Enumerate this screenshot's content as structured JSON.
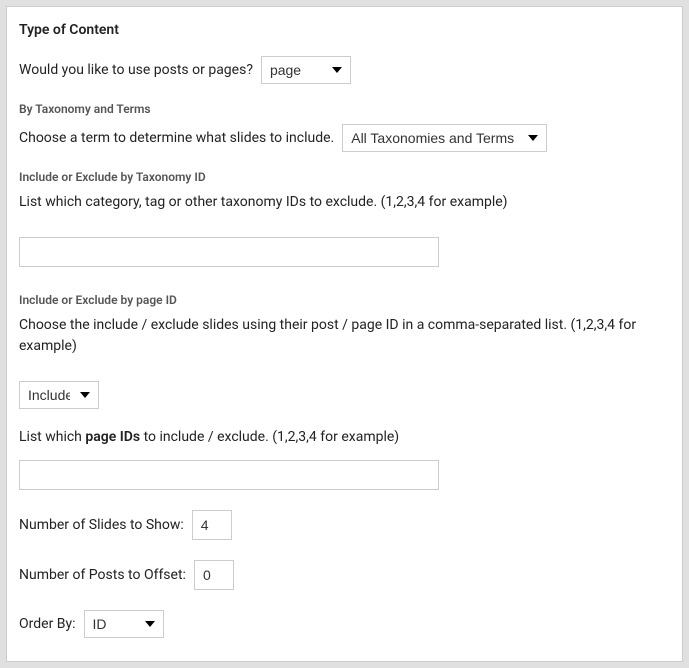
{
  "title": "Type of Content",
  "posts_or_pages": {
    "label": "Would you like to use posts or pages?",
    "value": "page"
  },
  "taxonomy": {
    "heading": "By Taxonomy and Terms",
    "label": "Choose a term to determine what slides to include.",
    "value": "All Taxonomies and Terms"
  },
  "exclude_tax": {
    "heading": "Include or Exclude by Taxonomy ID",
    "desc": "List which category, tag or other taxonomy IDs to exclude. (1,2,3,4 for example)",
    "value": ""
  },
  "page_id": {
    "heading": "Include or Exclude by page ID",
    "desc": "Choose the include / exclude slides using their post / page ID in a comma-separated list. (1,2,3,4 for example)",
    "mode": "Include",
    "list_prefix": "List which ",
    "list_bold": "page IDs",
    "list_suffix": " to include / exclude. (1,2,3,4 for example)",
    "value": ""
  },
  "slides_to_show": {
    "label": "Number of Slides to Show:",
    "value": "4"
  },
  "posts_offset": {
    "label": "Number of Posts to Offset:",
    "value": "0"
  },
  "order_by": {
    "label": "Order By:",
    "value": "ID"
  }
}
